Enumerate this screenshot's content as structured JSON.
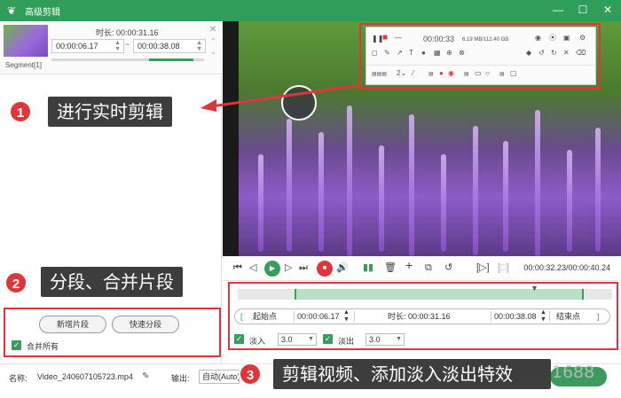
{
  "titlebar": {
    "title": "高级剪辑"
  },
  "segment": {
    "label": "Segment[1]",
    "duration": "时长: 00:00:31.16",
    "start": "00:00:06.17",
    "end": "00:00:38.08",
    "tilde": "~"
  },
  "recorder_toolbar": {
    "timer": "00:00:33",
    "size": "6.19 MB/112.40 GB"
  },
  "annotations": [
    {
      "number": "1",
      "text": "进行实时剪辑"
    },
    {
      "number": "2",
      "text": "分段、合并片段"
    },
    {
      "number": "3",
      "text": "剪辑视频、添加淡入淡出特效"
    }
  ],
  "segment_actions": {
    "new_segment": "新增片段",
    "quick_split": "快速分段",
    "merge_all": "合并所有"
  },
  "playback": {
    "timecode": "00:00:32.23/00:00:40.24"
  },
  "range": {
    "start_label": "起始点",
    "start_time": "00:00:06.17",
    "duration_label": "时长: 00:00:31.16",
    "end_time": "00:00:38.08",
    "end_label": "结束点"
  },
  "fade": {
    "fade_in_label": "淡入",
    "fade_in_value": "3.0",
    "fade_out_label": "淡出",
    "fade_out_value": "3.0"
  },
  "output": {
    "name_label": "名称:",
    "filename": "Video_240607105723.mp4",
    "output_label": "输出:",
    "output_value": "自动(Auto)"
  },
  "watermark": "掘金技术社区 @ xiekeji1688",
  "colors": {
    "accent": "#3a9c5c",
    "highlight": "#e0363b",
    "callout": "#3d3d3d"
  }
}
